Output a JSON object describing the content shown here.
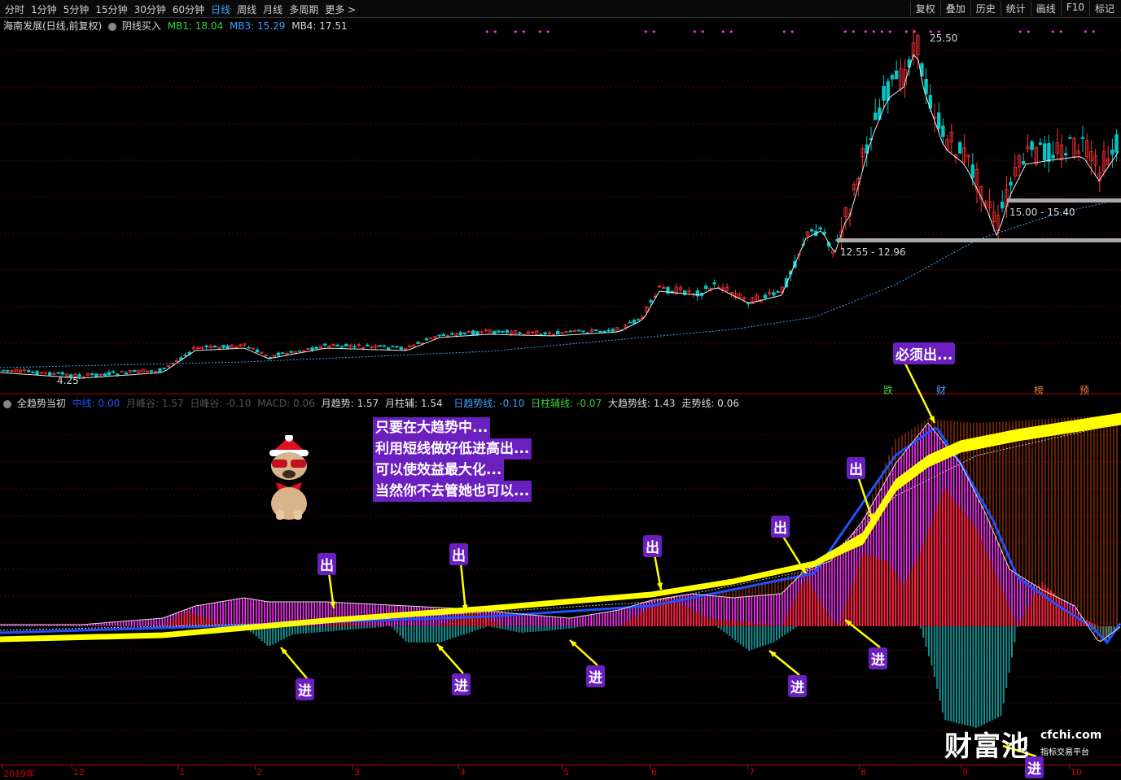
{
  "toolbar": {
    "periods": [
      "分时",
      "1分钟",
      "5分钟",
      "15分钟",
      "30分钟",
      "60分钟",
      "日线",
      "周线",
      "月线",
      "多周期",
      "更多 >"
    ],
    "active_period": "日线",
    "actions": [
      "复权",
      "叠加",
      "历史",
      "统计",
      "画线",
      "F10",
      "标记"
    ]
  },
  "main_info": {
    "title": "海南发展(日线,前复权)",
    "indicator": "阴线买入",
    "mb1": "MB1: 18.04",
    "mb3": "MB3: 15.29",
    "mb4": "MB4: 17.51"
  },
  "price_labels": {
    "high": "25.50",
    "low": "4.25",
    "zone1": "12.55 - 12.96",
    "zone2": "15.00 - 15.40"
  },
  "signal_tags": [
    "跌",
    "财",
    "榜",
    "预"
  ],
  "sub_info": {
    "title": "全趋势当初",
    "zhongxian": "中线: 0.00",
    "yuefeng": "月峰谷: 1.57",
    "rifeng": "日峰谷: -0.10",
    "macd": "MACD: 0.06",
    "yuequshi": "月趋势: 1.57",
    "yuezhufu": "月柱辅: 1.54",
    "riqushi": "日趋势线: -0.10",
    "rizhufu": "日柱辅线: -0.07",
    "daqushi": "大趋势线: 1.43",
    "zoushi": "走势线: 0.06"
  },
  "caption": [
    "只要在大趋势中...",
    "利用短线做好低进高出...",
    "可以使效益最大化...",
    "当然你不去管她也可以..."
  ],
  "annotations": {
    "out": "出",
    "in": "进",
    "must_out": "必须出..."
  },
  "x_axis": [
    "2019年",
    "12",
    "1",
    "2",
    "3",
    "4",
    "5",
    "6",
    "7",
    "8",
    "9",
    "10"
  ],
  "logo": {
    "name": "财富池",
    "site": "cfchi.com",
    "sub": "指标交易平台"
  },
  "colors": {
    "up": "#ff3030",
    "down": "#00c8c8",
    "ma": "#e6e6e6",
    "trend": "#ffff00",
    "pink": "#ff30ff",
    "red": "#ff2040",
    "teal": "#138080",
    "blue": "#2050ff"
  },
  "chart_data": {
    "type": "line",
    "title": "海南发展(日线,前复权)",
    "x": [
      "2019-11",
      "2019-12",
      "2020-01",
      "2020-02",
      "2020-03",
      "2020-04",
      "2020-05",
      "2020-06",
      "2020-07",
      "2020-08",
      "2020-09",
      "2020-10"
    ],
    "series": [
      {
        "name": "Close",
        "values": [
          4.3,
          4.6,
          5.5,
          6.0,
          5.5,
          6.5,
          6.8,
          10.0,
          10.5,
          24.0,
          15.5,
          17.5
        ]
      },
      {
        "name": "MB3",
        "values": [
          4.3,
          4.5,
          4.8,
          5.1,
          5.3,
          5.6,
          6.0,
          6.6,
          7.5,
          10.0,
          12.5,
          15.29
        ]
      }
    ],
    "ylim": [
      4.25,
      25.5
    ]
  }
}
